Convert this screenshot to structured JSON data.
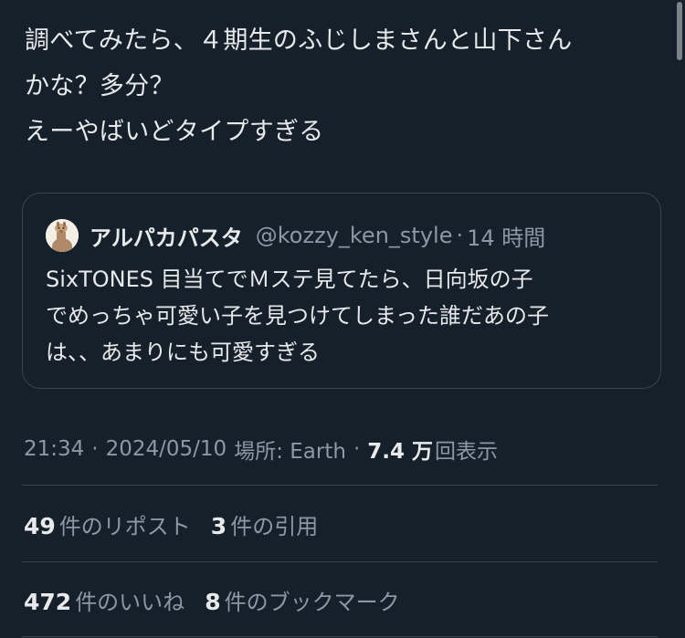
{
  "tweet": {
    "lines": [
      "調べてみたら、４期生のふじしまさんと山下さん",
      "かな？多分？",
      "えーやばいどタイプすぎる"
    ]
  },
  "quote": {
    "author_name": "アルパカパスタ",
    "author_handle": "@kozzy_ken_style",
    "separator": "·",
    "time": "14 時間",
    "avatar_icon": "alpaca-avatar-icon",
    "lines": [
      "SixTONES 目当てでＭステ見てたら、日向坂の子",
      "でめっちゃ可愛い子を見つけてしまった誰だあの子",
      "は、、あまりにも可愛すぎる"
    ]
  },
  "meta": {
    "time": "21:34",
    "separator": "·",
    "date": "2024/05/10",
    "location": "場所: Earth",
    "views_count": "7.4 万",
    "views_label": "回表示"
  },
  "stats": {
    "reposts_count": "49",
    "reposts_label": "件のリポスト",
    "quotes_count": "3",
    "quotes_label": "件の引用",
    "likes_count": "472",
    "likes_label": "件のいいね",
    "bookmarks_count": "8",
    "bookmarks_label": "件のブックマーク"
  },
  "colors": {
    "background": "#15202b",
    "text_primary": "#e7e9ea",
    "text_secondary": "#8b98a5",
    "border": "#38444d"
  }
}
